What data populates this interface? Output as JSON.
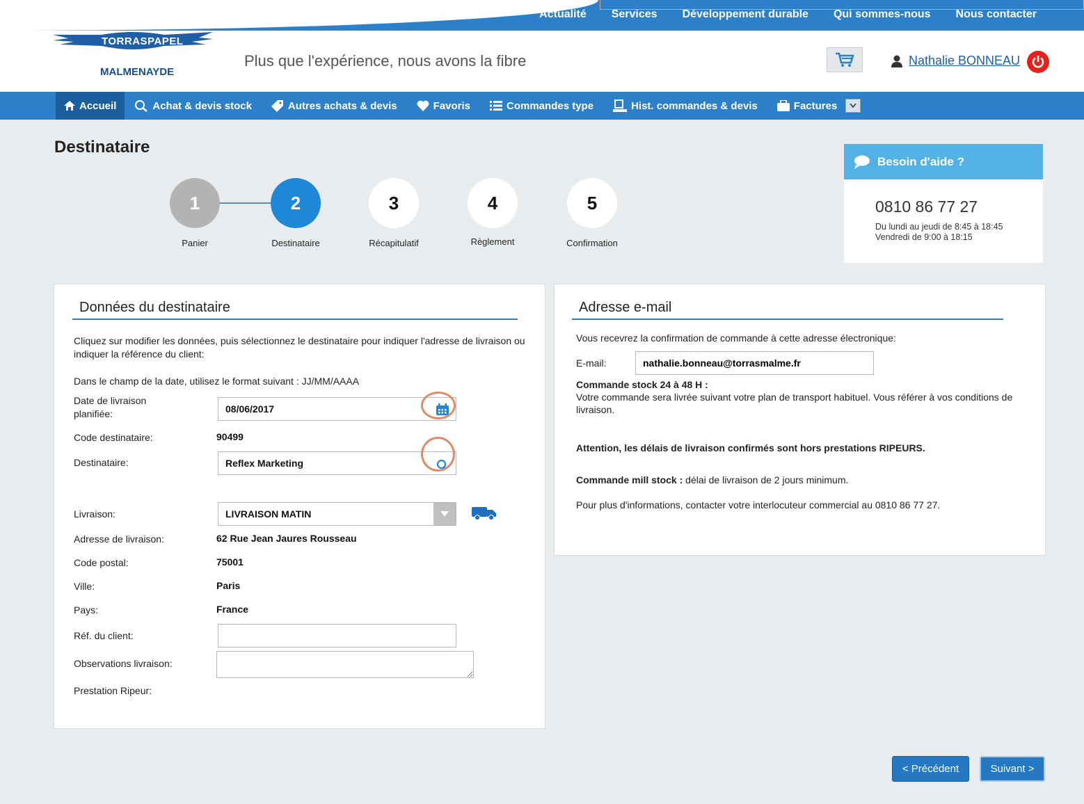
{
  "top_nav": {
    "links": [
      "Actualité",
      "Services",
      "Développement durable",
      "Qui sommes-nous",
      "Nous contacter"
    ]
  },
  "header": {
    "logo_top": "TORRASPAPEL",
    "logo_bottom": "MALMENAYDE",
    "tagline": "Plus que l'expérience, nous avons la fibre",
    "user_name": "Nathalie BONNEAU"
  },
  "main_nav": {
    "items": [
      "Accueil",
      "Achat & devis stock",
      "Autres achats & devis",
      "Favoris",
      "Commandes type",
      "Hist. commandes & devis",
      "Factures"
    ]
  },
  "page_title": "Destinataire",
  "steps": [
    {
      "num": "1",
      "label": "Panier"
    },
    {
      "num": "2",
      "label": "Destinataire"
    },
    {
      "num": "3",
      "label": "Récapitulatif"
    },
    {
      "num": "4",
      "label": "Règlement"
    },
    {
      "num": "5",
      "label": "Confirmation"
    }
  ],
  "help": {
    "title": "Besoin d'aide ?",
    "phone": "0810 86 77 27",
    "hours1": "Du lundi au jeudi de 8:45 à 18:45",
    "hours2": "Vendredi de 9:00 à 18:15"
  },
  "recipient": {
    "title": "Données du destinataire",
    "intro": "Cliquez sur modifier les données, puis sélectionnez le destinataire pour indiquer l'adresse de livraison ou indiquer la référence du client:",
    "date_hint": "Dans le champ de la date, utilisez le format suivant : JJ/MM/AAAA",
    "date_label": "Date de livraison planifiée:",
    "date_value": "08/06/2017",
    "code_label": "Code destinataire:",
    "code_value": "90499",
    "dest_label": "Destinataire:",
    "dest_value": "Reflex Marketing",
    "delivery_label": "Livraison:",
    "delivery_value": "LIVRAISON MATIN",
    "address_label": "Adresse de livraison:",
    "address_value": "62 Rue Jean Jaures Rousseau",
    "postal_label": "Code postal:",
    "postal_value": "75001",
    "city_label": "Ville:",
    "city_value": "Paris",
    "country_label": "Pays:",
    "country_value": "France",
    "ref_label": "Réf. du client:",
    "ref_value": "",
    "obs_label": "Observations livraison:",
    "obs_value": "",
    "ripeur_label": "Prestation Ripeur:"
  },
  "email": {
    "title": "Adresse e-mail",
    "intro": "Vous recevrez la confirmation de commande à cette adresse électronique:",
    "label": "E-mail:",
    "value": "nathalie.bonneau@torrasmalme.fr",
    "stock_title": "Commande stock 24 à 48 H :",
    "stock_text": "Votre commande sera livrée suivant votre plan de transport habituel. Vous référer à vos conditions de livraison.",
    "warning": "Attention, les délais de livraison confirmés sont hors prestations RIPEURS.",
    "mill_title": "Commande mill stock :",
    "mill_text": " délai de livraison de 2 jours minimum.",
    "contact": "Pour plus d'informations, contacter votre interlocuteur commercial au 0810 86 77 27."
  },
  "buttons": {
    "prev": "< Précédent",
    "next": "Suivant >"
  },
  "colors": {
    "nav_blue": "#2b80c9",
    "step_active": "#1e88d6",
    "help_header": "#52b1e5",
    "annotation_ring": "#e08a6a"
  }
}
